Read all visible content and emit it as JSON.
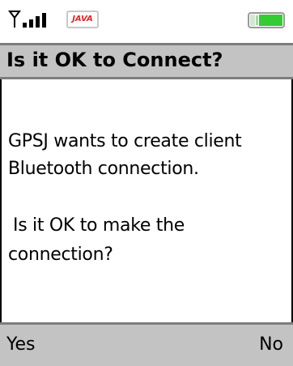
{
  "status_bar": {
    "signal_icon": "signal-strength-icon",
    "java_badge": "JAVA",
    "battery_icon": "battery-icon",
    "accent_color": "#33cc33"
  },
  "dialog": {
    "title": "Is it OK to Connect?",
    "message_line1": "GPSJ wants to create client",
    "message_line2": "Bluetooth connection.",
    "message_line3": "Is it OK to make the",
    "message_line4": "connection?"
  },
  "softkeys": {
    "left": "Yes",
    "right": "No"
  },
  "colors": {
    "bar_background": "#c3c3c3",
    "bar_border": "#7d7d7d",
    "java_red": "#e0242a"
  }
}
